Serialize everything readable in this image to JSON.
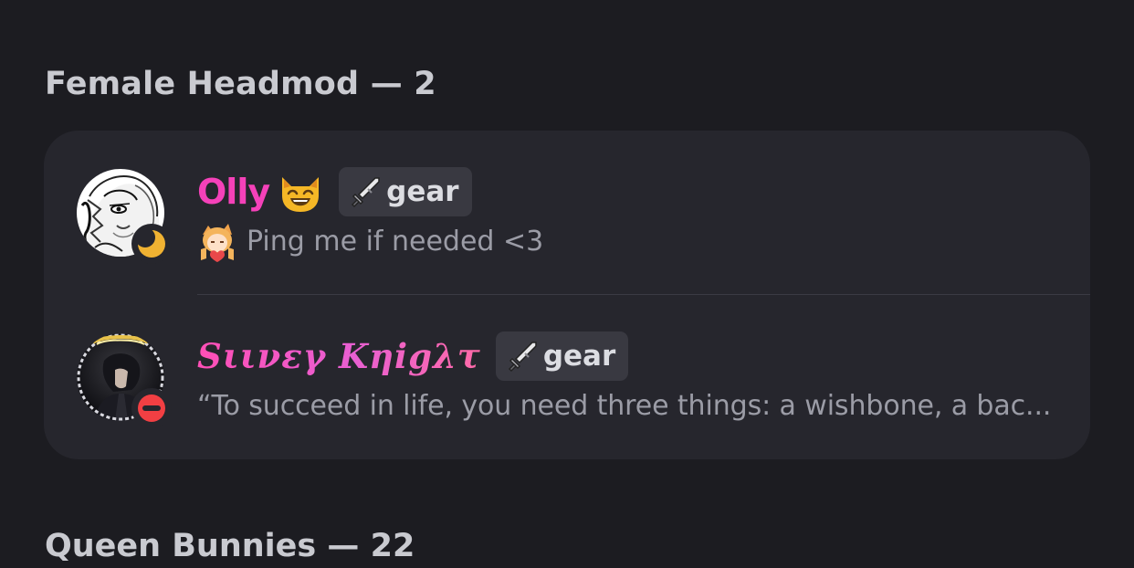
{
  "section": {
    "header": "Female Headmod — 2",
    "next_header": "Queen Bunnies — 22"
  },
  "members": [
    {
      "name": "Olly",
      "name_emoji": "smiling-cat-emoji",
      "badge": {
        "icon": "dagger-icon",
        "label": "gear"
      },
      "status": "idle",
      "status_icon": "crescent-moon-icon",
      "custom_status_emoji": "anime-girl-heart-emoji",
      "custom_status": "Ping me if needed <3"
    },
    {
      "name": "Sιινεγ Kηigλτ",
      "badge": {
        "icon": "dagger-icon",
        "label": "gear"
      },
      "status": "do-not-disturb",
      "status_icon": "dnd-icon",
      "custom_status": "“To succeed in life, you need three things: a wishbone, a bac..."
    }
  ],
  "colors": {
    "background": "#1c1c21",
    "card": "#26262d",
    "name_pink": "#f541b9",
    "idle": "#f0b232",
    "dnd": "#f23f43",
    "muted_text": "#9b9ca6"
  }
}
